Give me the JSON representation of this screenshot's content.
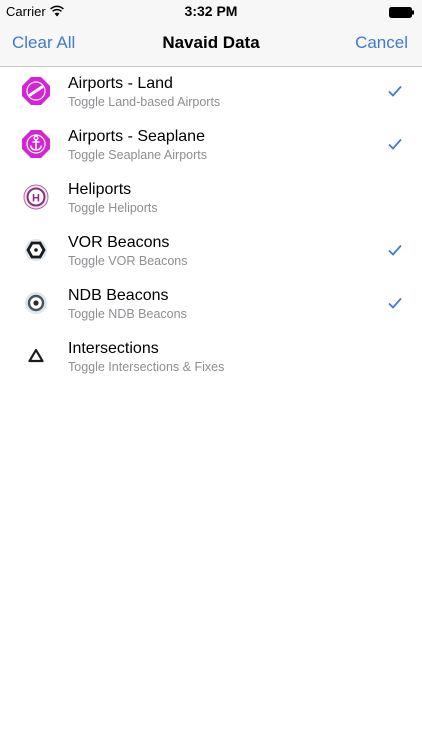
{
  "status_bar": {
    "carrier": "Carrier",
    "time": "3:32 PM",
    "wifi_icon": "wifi-icon",
    "battery_icon": "battery-icon"
  },
  "nav": {
    "left_label": "Clear All",
    "title": "Navaid Data",
    "right_label": "Cancel"
  },
  "colors": {
    "accent": "#3f7ad6",
    "airport": "#d424d4",
    "subtitle": "#8e8e93"
  },
  "items": [
    {
      "title": "Airports - Land",
      "subtitle": "Toggle Land-based Airports",
      "icon": "airport-land-icon",
      "checked": true
    },
    {
      "title": "Airports - Seaplane",
      "subtitle": "Toggle Seaplane Airports",
      "icon": "airport-seaplane-icon",
      "checked": true
    },
    {
      "title": "Heliports",
      "subtitle": "Toggle Heliports",
      "icon": "heliport-icon",
      "checked": false
    },
    {
      "title": "VOR Beacons",
      "subtitle": "Toggle VOR Beacons",
      "icon": "vor-beacon-icon",
      "checked": true
    },
    {
      "title": "NDB Beacons",
      "subtitle": "Toggle NDB Beacons",
      "icon": "ndb-beacon-icon",
      "checked": true
    },
    {
      "title": "Intersections",
      "subtitle": "Toggle Intersections & Fixes",
      "icon": "intersection-icon",
      "checked": false
    }
  ]
}
